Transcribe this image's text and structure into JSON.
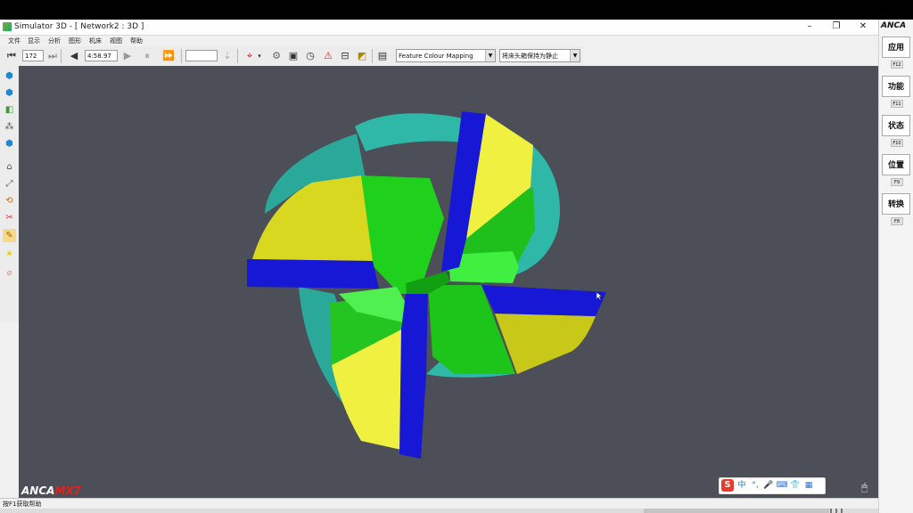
{
  "window": {
    "title": "Simulator 3D - [ Network2 : 3D ]",
    "minimize": "–",
    "maximize": "❐",
    "close": "✕"
  },
  "menu": [
    "文件",
    "显示",
    "分析",
    "图形",
    "机床",
    "视图",
    "帮助"
  ],
  "toolbar": {
    "frame_value": "172",
    "time_value": "4:58.97",
    "speed_value": "",
    "color_mapping": "Feature Colour Mapping",
    "view_mode": "将床头箱保持为静止"
  },
  "right_panel": {
    "logo": "ANCA",
    "buttons": [
      {
        "label": "应用",
        "key": "F12"
      },
      {
        "label": "功能",
        "key": "F11"
      },
      {
        "label": "状态",
        "key": "F10"
      },
      {
        "label": "位置",
        "key": "F9"
      },
      {
        "label": "转换",
        "key": "F8"
      }
    ]
  },
  "viewport": {
    "logo_anca": "ANCA",
    "logo_mx": "MX7"
  },
  "ime": {
    "logo": "S",
    "lang": "中",
    "punct": "°,",
    "mic": "🎤",
    "keyboard": "⌨",
    "skin": "👕",
    "grid": "▦"
  },
  "status": {
    "text": "按F1获取帮助"
  },
  "colors": {
    "viewport_bg": "#4c4e58",
    "teal": "#2fb8a8",
    "green": "#24d620",
    "blue": "#1717d6",
    "yellow": "#e8e830"
  },
  "icons": {
    "left_toolbar": [
      "view-iso-icon",
      "view-top-icon",
      "view-front-icon",
      "view-multi-icon",
      "view-side-icon",
      "home-icon",
      "pan-icon",
      "rotate-icon",
      "section-icon",
      "tool-path-icon",
      "light-bulb-icon",
      "measure-icon"
    ]
  }
}
